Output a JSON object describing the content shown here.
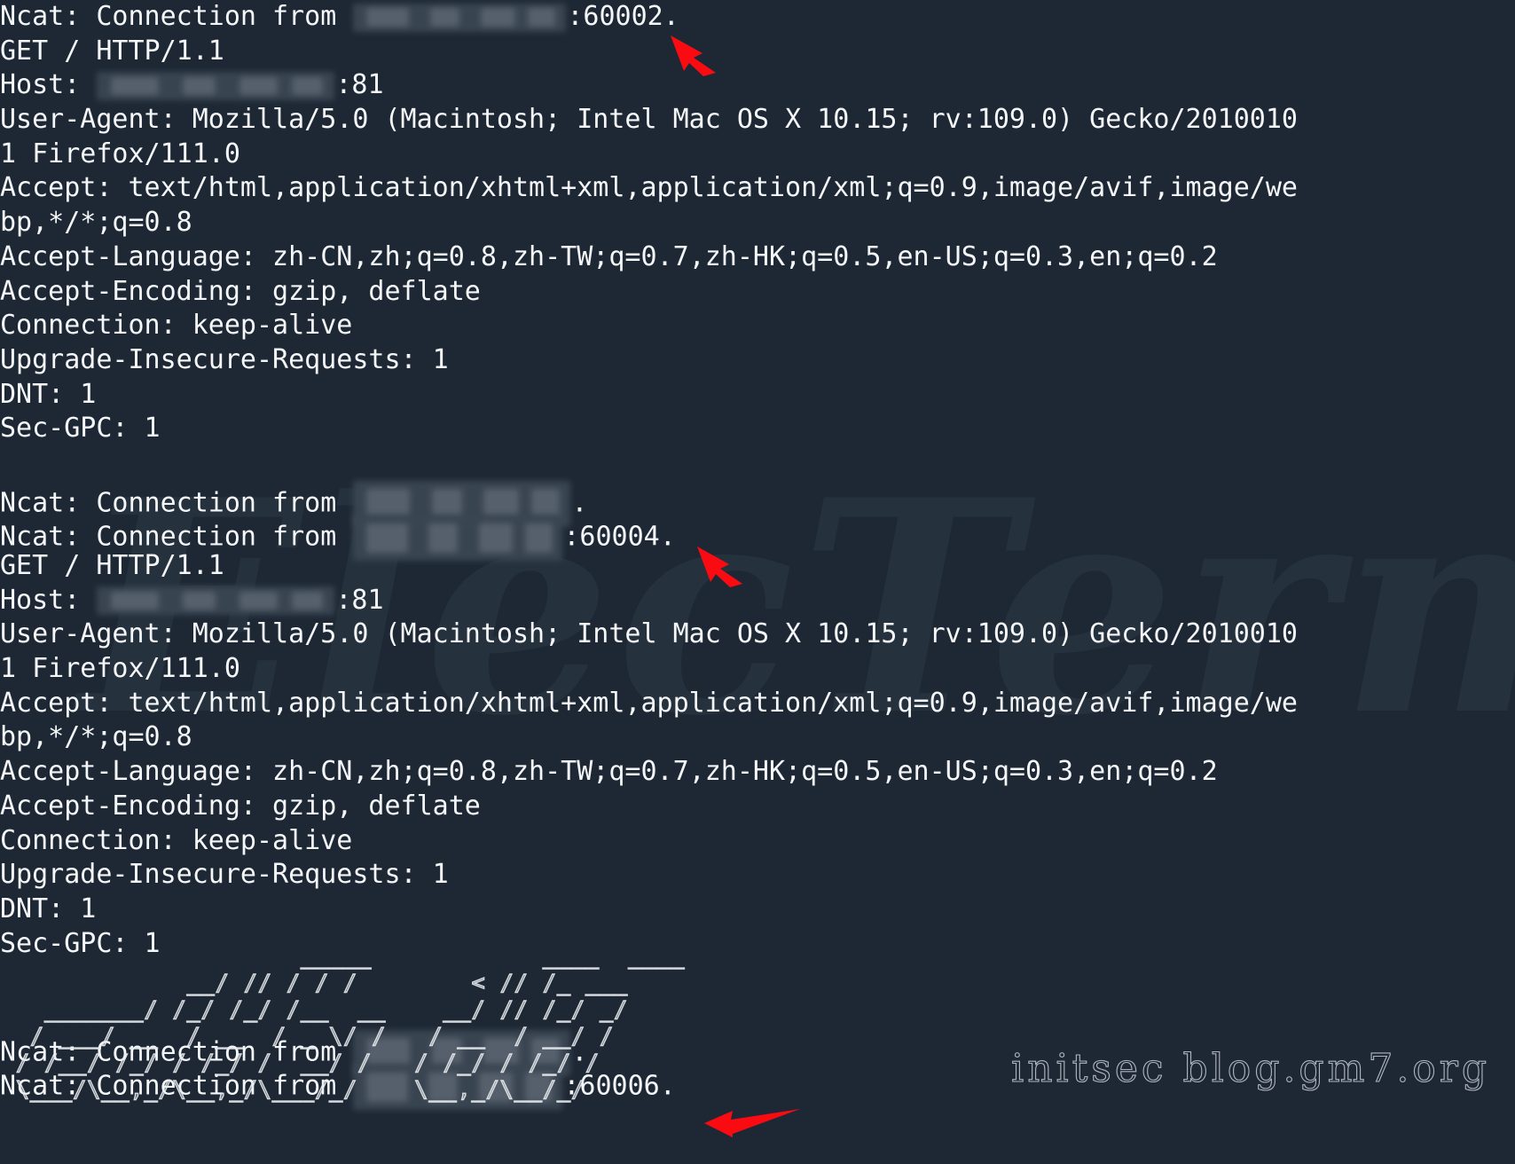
{
  "terminal": {
    "background_color": "#1e2835",
    "text_color": "#f4f6f8",
    "lines": [
      {
        "id": "l01",
        "pre": "Ncat: Connection from ",
        "redact": "r-long",
        "post": ":60002."
      },
      {
        "id": "l02",
        "text": "GET / HTTP/1.1"
      },
      {
        "id": "l03",
        "pre": "Host: ",
        "redact": "r-host",
        "post": ":81"
      },
      {
        "id": "l04",
        "text": "User-Agent: Mozilla/5.0 (Macintosh; Intel Mac OS X 10.15; rv:109.0) Gecko/2010010"
      },
      {
        "id": "l05",
        "text": "1 Firefox/111.0"
      },
      {
        "id": "l06",
        "text": "Accept: text/html,application/xhtml+xml,application/xml;q=0.9,image/avif,image/we"
      },
      {
        "id": "l07",
        "text": "bp,*/*;q=0.8"
      },
      {
        "id": "l08",
        "text": "Accept-Language: zh-CN,zh;q=0.8,zh-TW;q=0.7,zh-HK;q=0.5,en-US;q=0.3,en;q=0.2"
      },
      {
        "id": "l09",
        "text": "Accept-Encoding: gzip, deflate"
      },
      {
        "id": "l10",
        "text": "Connection: keep-alive"
      },
      {
        "id": "l11",
        "text": "Upgrade-Insecure-Requests: 1"
      },
      {
        "id": "l12",
        "text": "DNT: 1"
      },
      {
        "id": "l13",
        "text": "Sec-GPC: 1"
      },
      {
        "id": "l14",
        "text": ""
      },
      {
        "id": "l15",
        "pre": "Ncat: Connection from ",
        "redact": "r-mid",
        "post": "."
      },
      {
        "id": "l16",
        "pre": "Ncat: Connection from ",
        "redact": "r-short",
        "post": ":60004."
      },
      {
        "id": "l17",
        "text": "GET / HTTP/1.1"
      },
      {
        "id": "l18",
        "pre": "Host: ",
        "redact": "r-host",
        "post": ":81"
      },
      {
        "id": "l19",
        "text": "User-Agent: Mozilla/5.0 (Macintosh; Intel Mac OS X 10.15; rv:109.0) Gecko/2010010"
      },
      {
        "id": "l20",
        "text": "1 Firefox/111.0"
      },
      {
        "id": "l21",
        "text": "Accept: text/html,application/xhtml+xml,application/xml;q=0.9,image/avif,image/we"
      },
      {
        "id": "l22",
        "text": "bp,*/*;q=0.8"
      },
      {
        "id": "l23",
        "text": "Accept-Language: zh-CN,zh;q=0.8,zh-TW;q=0.7,zh-HK;q=0.5,en-US;q=0.3,en;q=0.2"
      },
      {
        "id": "l24",
        "text": "Accept-Encoding: gzip, deflate"
      },
      {
        "id": "l25",
        "text": "Connection: keep-alive"
      },
      {
        "id": "l26",
        "text": "Upgrade-Insecure-Requests: 1"
      },
      {
        "id": "l27",
        "text": "DNT: 1"
      },
      {
        "id": "l28",
        "text": "Sec-GPC: 1"
      },
      {
        "id": "l29",
        "text": ""
      },
      {
        "id": "l30",
        "text": ""
      },
      {
        "id": "l31",
        "pre": "Ncat: Connection from ",
        "redact": "r-mid",
        "post": "."
      },
      {
        "id": "l32",
        "pre": "Ncat: Connection from ",
        "redact": "r-short",
        "post": ":60006."
      }
    ]
  },
  "watermarks": {
    "background_text": "ElecTerm",
    "background_color": "#27323f",
    "blog_text": "initsec blog.gm7.org",
    "blog_color": "#c8ced6",
    "ascii_banner": "                    _____            ____  ____\n            __/ // / / /        < // /_ ___\n  _______/ /_/ /_/ /__  __    __/ // /_/ _/\n / ___/ __  / __  / _ \\/ /   / __  / __/ /\n/ /__/ /_/ / /_/ /  __/ /   / /_/ / /_/ /\n\\___/\\__,_/\\__,_/\\___/_/    \\__,_/\\__/_/"
  },
  "annotations": {
    "arrow_color": "#fa0b12",
    "arrows": [
      {
        "id": "arrow-60002",
        "label": "arrow-pointing-to-port-60002"
      },
      {
        "id": "arrow-60004",
        "label": "arrow-pointing-to-port-60004"
      },
      {
        "id": "arrow-60006",
        "label": "arrow-pointing-to-port-60006"
      }
    ]
  }
}
